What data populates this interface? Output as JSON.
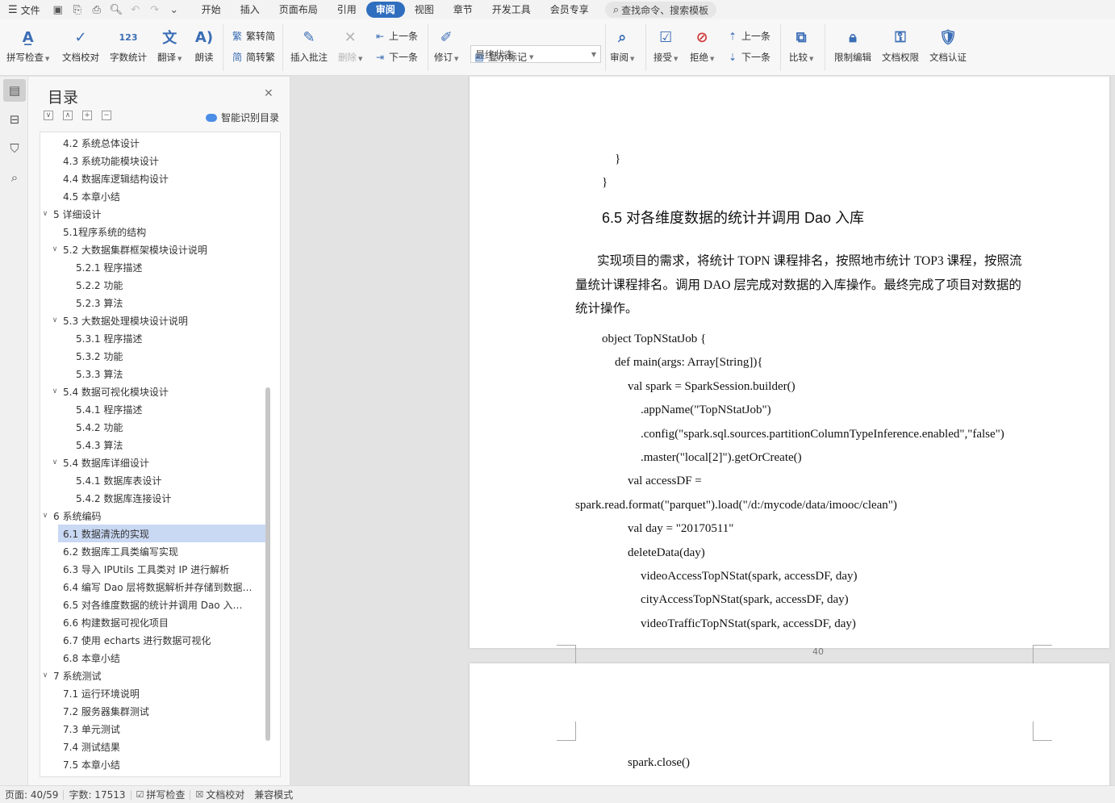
{
  "menubar": {
    "file_label": "文件",
    "tabs": [
      {
        "label": "开始"
      },
      {
        "label": "插入"
      },
      {
        "label": "页面布局"
      },
      {
        "label": "引用"
      },
      {
        "label": "审阅"
      },
      {
        "label": "视图"
      },
      {
        "label": "章节"
      },
      {
        "label": "开发工具"
      },
      {
        "label": "会员专享"
      }
    ],
    "active_tab": "审阅",
    "search_placeholder": "查找命令、搜索模板"
  },
  "ribbon": {
    "spell_check": "拼写检查",
    "doc_proofread": "文档校对",
    "word_count": "字数统计",
    "translate": "翻译",
    "read_aloud": "朗读",
    "to_traditional": "繁转简",
    "to_simplified": "简转繁",
    "insert_comment": "插入批注",
    "delete": "删除",
    "prev_comment": "上一条",
    "next_comment": "下一条",
    "track_changes": "修订",
    "status_value": "最终状态",
    "show_markup": "显示标记",
    "review": "审阅",
    "accept": "接受",
    "reject": "拒绝",
    "prev_change": "上一条",
    "next_change": "下一条",
    "compare": "比较",
    "restrict_edit": "限制编辑",
    "doc_permission": "文档权限",
    "doc_certify": "文档认证"
  },
  "toc": {
    "title": "目录",
    "smart_label": "智能识别目录",
    "items": [
      {
        "text": "4.2  系统总体设计",
        "level": 2,
        "twisty": ""
      },
      {
        "text": "4.3  系统功能模块设计",
        "level": 2,
        "twisty": ""
      },
      {
        "text": "4.4  数据库逻辑结构设计",
        "level": 2,
        "twisty": ""
      },
      {
        "text": "4.5  本章小结",
        "level": 2,
        "twisty": ""
      },
      {
        "text": "5    详细设计",
        "level": 1,
        "twisty": "∨"
      },
      {
        "text": "5.1程序系统的结构",
        "level": 2,
        "twisty": ""
      },
      {
        "text": "5.2    大数据集群框架模块设计说明",
        "level": 2,
        "twisty": "∨"
      },
      {
        "text": "5.2.1  程序描述",
        "level": 3,
        "twisty": ""
      },
      {
        "text": "5.2.2  功能",
        "level": 3,
        "twisty": ""
      },
      {
        "text": "5.2.3  算法",
        "level": 3,
        "twisty": ""
      },
      {
        "text": "5.3    大数据处理模块设计说明",
        "level": 2,
        "twisty": "∨"
      },
      {
        "text": "5.3.1  程序描述",
        "level": 3,
        "twisty": ""
      },
      {
        "text": "5.3.2  功能",
        "level": 3,
        "twisty": ""
      },
      {
        "text": "5.3.3  算法",
        "level": 3,
        "twisty": ""
      },
      {
        "text": "5.4    数据可视化模块设计",
        "level": 2,
        "twisty": "∨"
      },
      {
        "text": "5.4.1  程序描述",
        "level": 3,
        "twisty": ""
      },
      {
        "text": "5.4.2  功能",
        "level": 3,
        "twisty": ""
      },
      {
        "text": "5.4.3  算法",
        "level": 3,
        "twisty": ""
      },
      {
        "text": "5.4    数据库详细设计",
        "level": 2,
        "twisty": "∨"
      },
      {
        "text": "5.4.1  数据库表设计",
        "level": 3,
        "twisty": ""
      },
      {
        "text": "5.4.2  数据库连接设计",
        "level": 3,
        "twisty": ""
      },
      {
        "text": "6    系统编码",
        "level": 1,
        "twisty": "∨"
      },
      {
        "text": "6.1  数据清洗的实现",
        "level": 2,
        "twisty": ""
      },
      {
        "text": "6.2  数据库工具类编写实现",
        "level": 2,
        "twisty": ""
      },
      {
        "text": "6.3 导入 IPUtils 工具类对 IP 进行解析",
        "level": 2,
        "twisty": ""
      },
      {
        "text": "6.4 编写 Dao 层将数据解析并存储到数据…",
        "level": 2,
        "twisty": ""
      },
      {
        "text": "6.5  对各维度数据的统计并调用 Dao 入…",
        "level": 2,
        "twisty": ""
      },
      {
        "text": "6.6  构建数据可视化项目",
        "level": 2,
        "twisty": ""
      },
      {
        "text": "6.7  使用 echarts 进行数据可视化",
        "level": 2,
        "twisty": ""
      },
      {
        "text": "6.8  本章小结",
        "level": 2,
        "twisty": ""
      },
      {
        "text": "7    系统测试",
        "level": 1,
        "twisty": "∨"
      },
      {
        "text": "7.1  运行环境说明",
        "level": 2,
        "twisty": ""
      },
      {
        "text": "7.2  服务器集群测试",
        "level": 2,
        "twisty": ""
      },
      {
        "text": "7.3  单元测试",
        "level": 2,
        "twisty": ""
      },
      {
        "text": "7.4  测试结果",
        "level": 2,
        "twisty": ""
      },
      {
        "text": "7.5  本章小结",
        "level": 2,
        "twisty": ""
      }
    ],
    "active_index": 22
  },
  "document": {
    "brace_close_1": "}",
    "brace_close_2": "}",
    "heading": "6.5  对各维度数据的统计并调用 Dao 入库",
    "para_line_1": "实现项目的需求，将统计 TOPN 课程排名，按照地市统计 TOP3 课程，按照流",
    "para_line_2": "量统计课程排名。调用 DAO 层完成对数据的入库操作。最终完成了项目对数据的",
    "para_line_3": "统计操作。",
    "code": [
      "object TopNStatJob {",
      "def main(args: Array[String]){",
      "val spark = SparkSession.builder()",
      ".appName(\"TopNStatJob\")",
      ".config(\"spark.sql.sources.partitionColumnTypeInference.enabled\",\"false\")",
      ".master(\"local[2]\").getOrCreate()",
      "val accessDF =",
      "spark.read.format(\"parquet\").load(\"/d:/mycode/data/imooc/clean\")",
      "val day = \"20170511\"",
      "deleteData(day)",
      "videoAccessTopNStat(spark, accessDF, day)",
      "cityAccessTopNStat(spark, accessDF, day)",
      "videoTrafficTopNStat(spark, accessDF, day)"
    ],
    "page_number": "40",
    "page2_code": "spark.close()"
  },
  "statusbar": {
    "page": "页面: 40/59",
    "words": "字数: 17513",
    "spell_check": "拼写检查",
    "proofread": "文档校对",
    "compat_mode": "兼容模式"
  }
}
